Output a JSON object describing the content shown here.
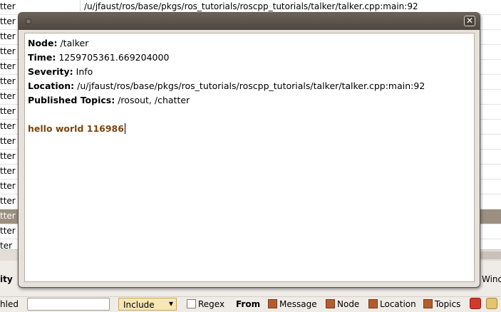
{
  "background_table": {
    "top_path": "/u/jfaust/ros/base/pkgs/ros_tutorials/roscpp_tutorials/talker/talker.cpp:main:92",
    "row_fragment": "tter",
    "row_fragment_alt": "ter"
  },
  "filter_header": {
    "left_fragment": "ity",
    "right_fragment": "Wind"
  },
  "toolbar": {
    "left_label": "hled",
    "combo_value": "Include",
    "regex_label": "Regex",
    "from_label": "From",
    "message_label": "Message",
    "node_label": "Node",
    "location_label": "Location",
    "topics_label": "Topics"
  },
  "dialog": {
    "close_glyph": "✕",
    "node_label": "Node:",
    "node_value": "/talker",
    "time_label": "Time:",
    "time_value": "1259705361.669204000",
    "severity_label": "Severity:",
    "severity_value": "Info",
    "location_label": "Location:",
    "location_value": "/u/jfaust/ros/base/pkgs/ros_tutorials/roscpp_tutorials/talker/talker.cpp:main:92",
    "topics_label": "Published Topics:",
    "topics_value": "/rosout, /chatter",
    "message": "hello world 116986"
  },
  "colors": {
    "selected_row": "#9c8f80",
    "message_text": "#7a4510",
    "titlebar": "#4e4740"
  }
}
